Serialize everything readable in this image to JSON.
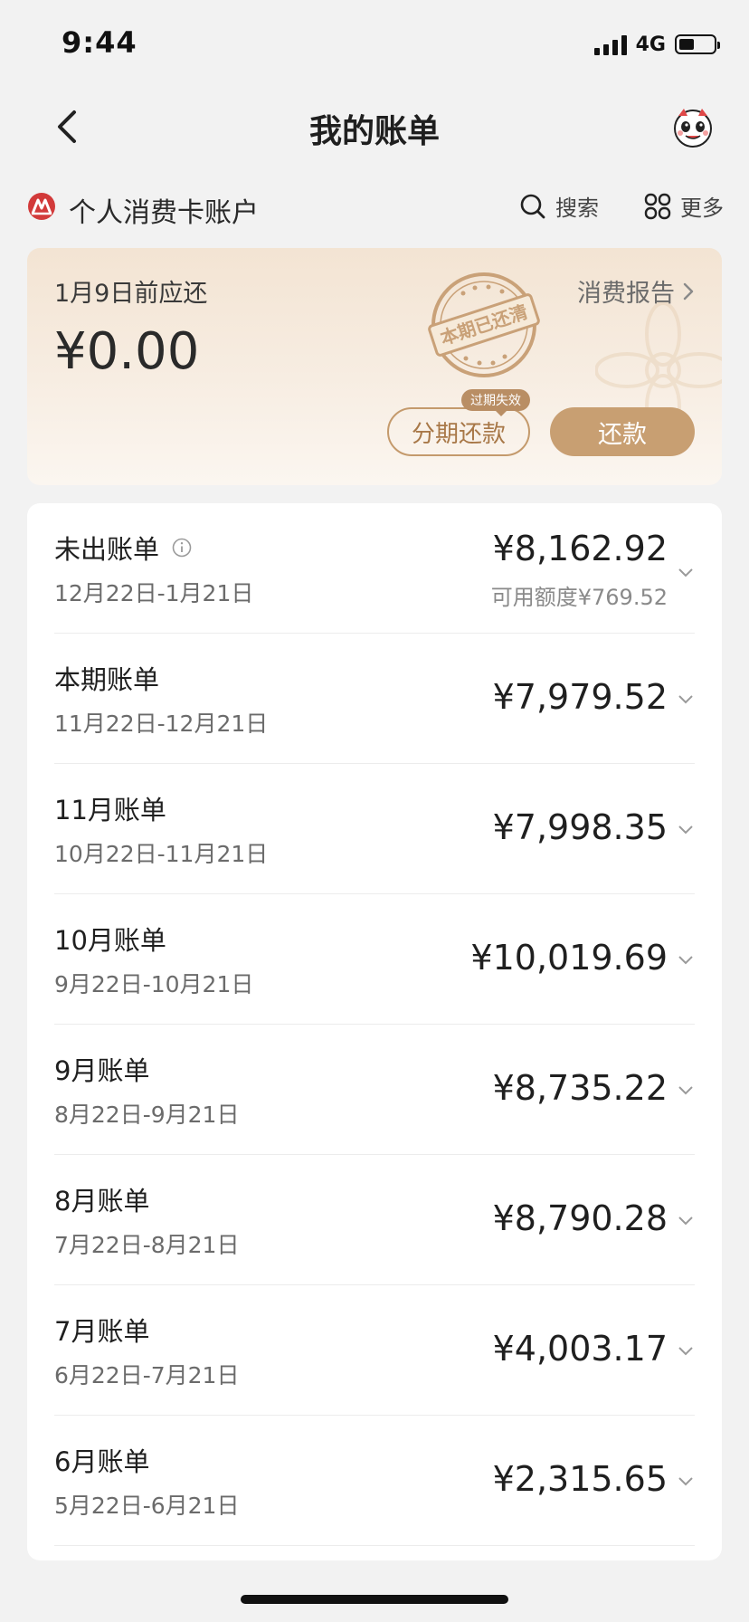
{
  "status_bar": {
    "time": "9:44",
    "network": "4G",
    "battery_level": 0.45
  },
  "nav": {
    "title": "我的账单",
    "icons": {
      "back": "chevron-left-icon",
      "assistant": "mascot-icon"
    }
  },
  "account": {
    "name": "个人消费卡账户",
    "search_label": "搜索",
    "more_label": "更多",
    "icons": {
      "logo": "bank-logo-icon",
      "search": "search-icon",
      "more": "grid-icon"
    }
  },
  "repay_card": {
    "due_label": "1月9日前应还",
    "amount": "¥0.00",
    "report_label": "消费报告",
    "stamp_text": "本期已还清",
    "installment_label": "分期还款",
    "expired_badge": "过期失效",
    "repay_label": "还款"
  },
  "bills": [
    {
      "title": "未出账单",
      "range": "12月22日-1月21日",
      "amount": "¥8,162.92",
      "sub": "可用额度¥769.52",
      "has_info": true
    },
    {
      "title": "本期账单",
      "range": "11月22日-12月21日",
      "amount": "¥7,979.52"
    },
    {
      "title": "11月账单",
      "range": "10月22日-11月21日",
      "amount": "¥7,998.35"
    },
    {
      "title": "10月账单",
      "range": "9月22日-10月21日",
      "amount": "¥10,019.69"
    },
    {
      "title": "9月账单",
      "range": "8月22日-9月21日",
      "amount": "¥8,735.22"
    },
    {
      "title": "8月账单",
      "range": "7月22日-8月21日",
      "amount": "¥8,790.28"
    },
    {
      "title": "7月账单",
      "range": "6月22日-7月21日",
      "amount": "¥4,003.17"
    },
    {
      "title": "6月账单",
      "range": "5月22日-6月21日",
      "amount": "¥2,315.65"
    }
  ],
  "colors": {
    "accent": "#c89f72",
    "accent_text": "#a87848",
    "brand_red": "#d23a3a"
  }
}
